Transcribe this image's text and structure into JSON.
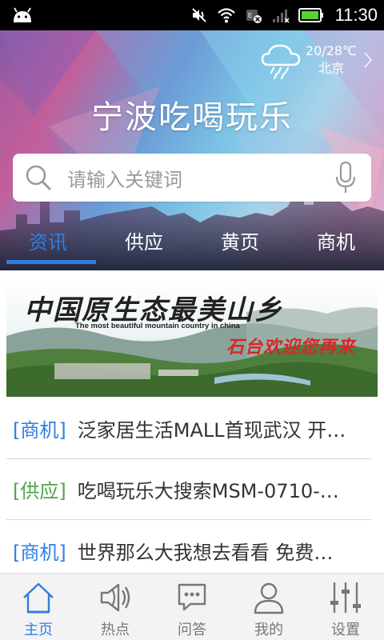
{
  "status_bar": {
    "time": "11:30",
    "icons": [
      "android-icon",
      "mute-icon",
      "wifi-icon",
      "battery-saver-icon",
      "signal-icon",
      "battery-icon"
    ]
  },
  "header": {
    "title": "宁波吃喝玩乐",
    "weather": {
      "temperature": "20/28℃",
      "city": "北京",
      "icon": "rain-cloud-icon"
    },
    "search": {
      "placeholder": "请输入关键词"
    },
    "tabs": [
      {
        "label": "资讯",
        "active": true
      },
      {
        "label": "供应",
        "active": false
      },
      {
        "label": "黄页",
        "active": false
      },
      {
        "label": "商机",
        "active": false
      }
    ]
  },
  "banner": {
    "headline": "中国原生态最美山乡",
    "subtitle": "The most beautiful mountain country in china",
    "slogan": "石台欢迎您再来"
  },
  "news": [
    {
      "tag": "[商机]",
      "tag_color": "#2f7fe0",
      "text": "泛家居生活MALL首现武汉 开…"
    },
    {
      "tag": "[供应]",
      "tag_color": "#4aa84c",
      "text": "吃喝玩乐大搜索MSM-0710-…"
    },
    {
      "tag": "[商机]",
      "tag_color": "#2f7fe0",
      "text": "世界那么大我想去看看 免费…"
    }
  ],
  "bottom_nav": [
    {
      "label": "主页",
      "icon": "home-icon",
      "active": true
    },
    {
      "label": "热点",
      "icon": "speaker-icon",
      "active": false
    },
    {
      "label": "问答",
      "icon": "chat-icon",
      "active": false
    },
    {
      "label": "我的",
      "icon": "user-icon",
      "active": false
    },
    {
      "label": "设置",
      "icon": "sliders-icon",
      "active": false
    }
  ],
  "colors": {
    "accent": "#2f7fe0",
    "supply_green": "#4aa84c",
    "banner_red": "#d8262a"
  }
}
